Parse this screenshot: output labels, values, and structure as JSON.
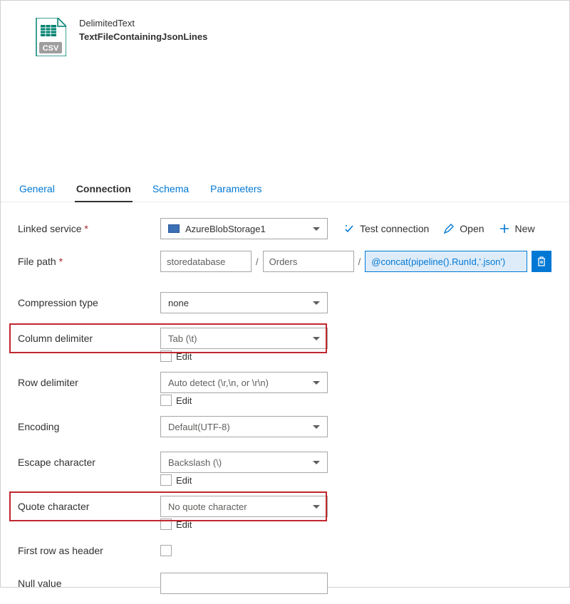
{
  "header": {
    "type_label": "DelimitedText",
    "dataset_name": "TextFileContainingJsonLines",
    "icon_badge": "CSV"
  },
  "tabs": {
    "general": "General",
    "connection": "Connection",
    "schema": "Schema",
    "parameters": "Parameters"
  },
  "form": {
    "linked_service_label": "Linked service",
    "linked_service_value": "AzureBlobStorage1",
    "test_connection": "Test connection",
    "open": "Open",
    "new": "New",
    "file_path_label": "File path",
    "file_path_container": "storedatabase",
    "file_path_dir": "Orders",
    "file_path_expr": "@concat(pipeline().RunId,'.json')",
    "compression_type_label": "Compression type",
    "compression_type_value": "none",
    "column_delim_label": "Column delimiter",
    "column_delim_value": "Tab (\\t)",
    "edit": "Edit",
    "row_delim_label": "Row delimiter",
    "row_delim_value": "Auto detect (\\r,\\n, or \\r\\n)",
    "encoding_label": "Encoding",
    "encoding_value": "Default(UTF-8)",
    "escape_label": "Escape character",
    "escape_value": "Backslash (\\)",
    "quote_label": "Quote character",
    "quote_value": "No quote character",
    "first_row_label": "First row as header",
    "null_value_label": "Null value"
  }
}
